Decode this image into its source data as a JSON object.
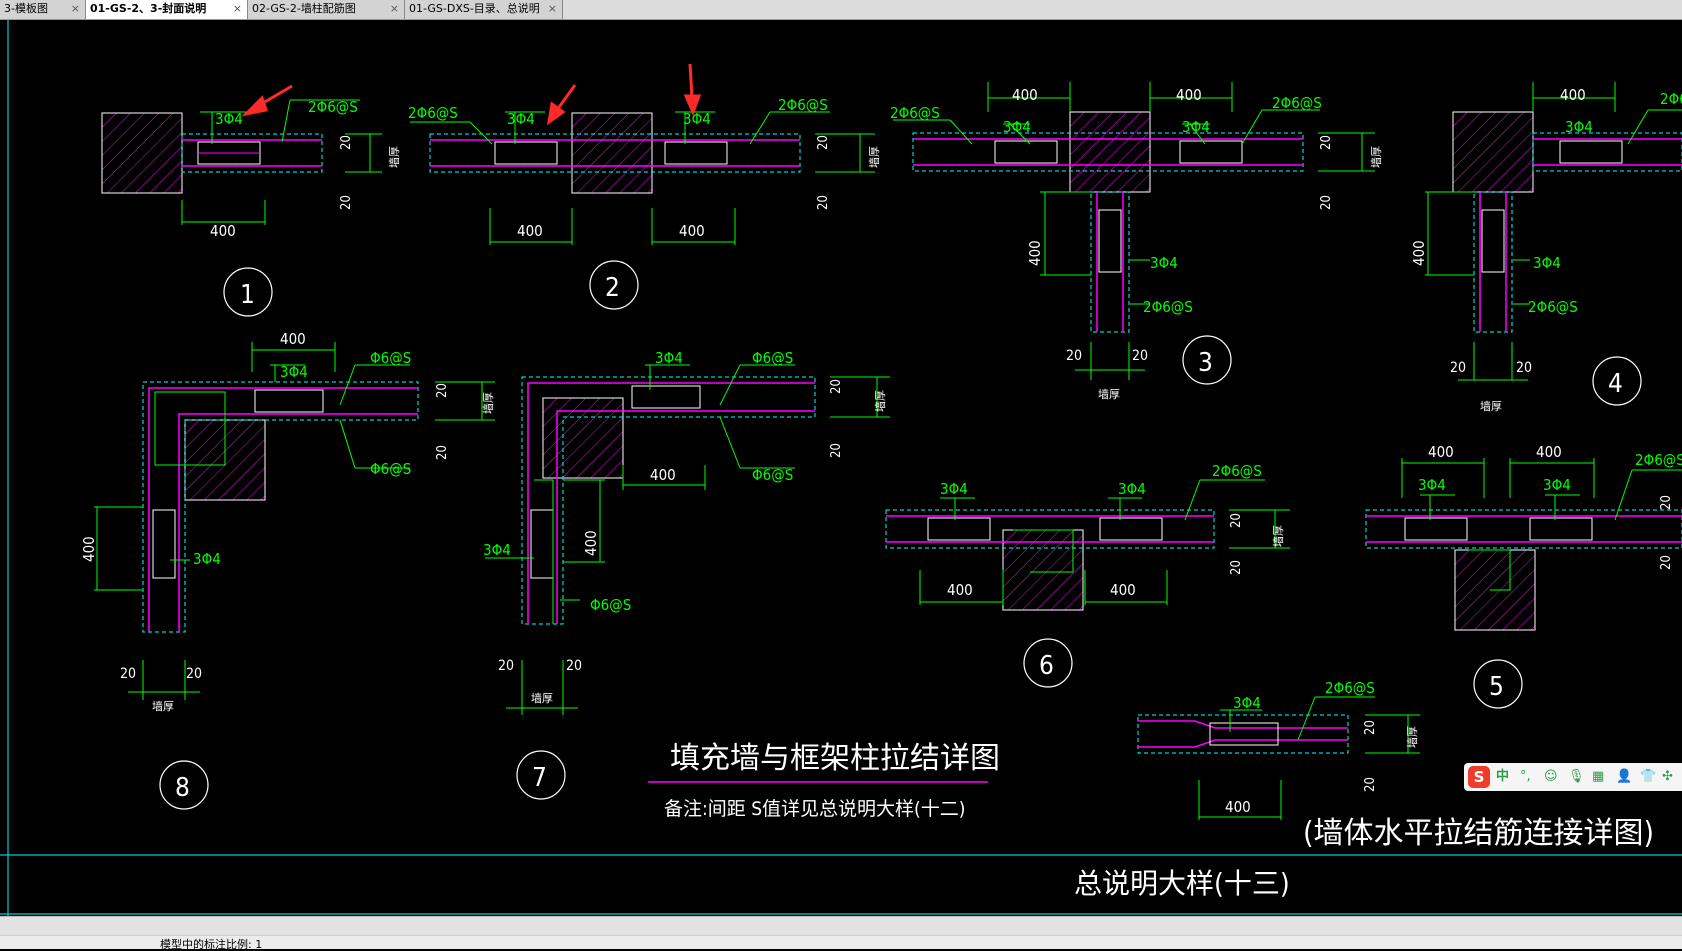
{
  "tabs": [
    {
      "label": "3-模板图",
      "active": false
    },
    {
      "label": "01-GS-2、3-封面说明",
      "active": true
    },
    {
      "label": "02-GS-2-墙柱配筋图",
      "active": false
    },
    {
      "label": "01-GS-DXS-目录、总说明",
      "active": false
    }
  ],
  "tab_close_glyph": "×",
  "drawing": {
    "labels": {
      "bar3": "3Φ4",
      "bar2": "2Φ6@S",
      "bar1": "Φ6@S",
      "d400": "400",
      "d20": "20",
      "wall_thk": "墙厚"
    },
    "detail_numbers": [
      "1",
      "2",
      "3",
      "4",
      "5",
      "6",
      "7",
      "8"
    ],
    "main_title": "填充墙与框架柱拉结详图",
    "note": "备注:间距 S值详见总说明大样(十二)",
    "sub_title": "(墙体水平拉结筋连接详图)",
    "sheet_title": "总说明大样(十三)",
    "colors": {
      "wall": "#ff00ff",
      "dim": "#00ff00",
      "dash": "#00ffff",
      "line": "#ffffff",
      "arrow": "#ff2a2a",
      "frame": "#00cccc"
    }
  },
  "ime_toolbar": {
    "logo": "S",
    "items": [
      "中",
      "°,",
      "☺",
      "🎙",
      "▦",
      "👤",
      "👕",
      "✣"
    ]
  },
  "statusbar": {
    "text": "模型中的标注比例: 1"
  }
}
